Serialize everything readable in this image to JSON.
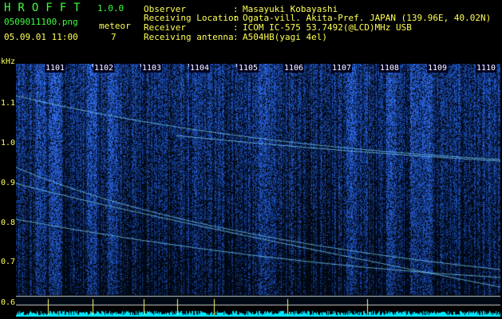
{
  "header": {
    "app_title": "HROFFT",
    "app_version": "1.0.0",
    "filename": "0509011100.png",
    "meteor_label": "meteor",
    "meteor_count": "7",
    "datetime": "05.09.01 11:00"
  },
  "station": [
    {
      "label": "Observer",
      "value": "Masayuki Kobayashi"
    },
    {
      "label": "Receiving Location",
      "value": "Ogata-vill. Akita-Pref. JAPAN (139.96E, 40.02N)"
    },
    {
      "label": "Receiver",
      "value": "ICOM IC-575 53.7492(@LCD)MHz USB"
    },
    {
      "label": "Receiving antenna",
      "value": "A504HB(yagi 4el)"
    }
  ],
  "spectrogram": {
    "y_unit": "kHz",
    "y_ticks": [
      "1.1",
      "1.0",
      "0.9",
      "0.8",
      "0.7",
      "0.6"
    ],
    "x_ticks": [
      "1101",
      "1102",
      "1103",
      "1104",
      "1105",
      "1106",
      "1107",
      "1108",
      "1109",
      "1110"
    ],
    "colors": {
      "background": "#000814",
      "noise": "#2a5cff",
      "trace": "#7fd8ff",
      "baseline": "#00e5ff",
      "marker": "#ffff66"
    }
  }
}
